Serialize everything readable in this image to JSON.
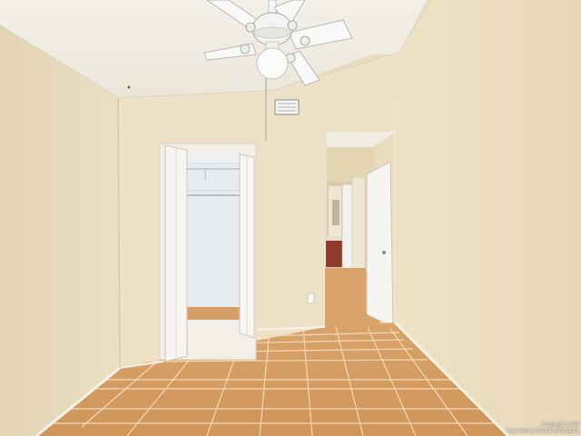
{
  "photo": {
    "watermark": {
      "line1": "Copyright 2023",
      "line2": "San Antonio Board of Realtors"
    }
  }
}
